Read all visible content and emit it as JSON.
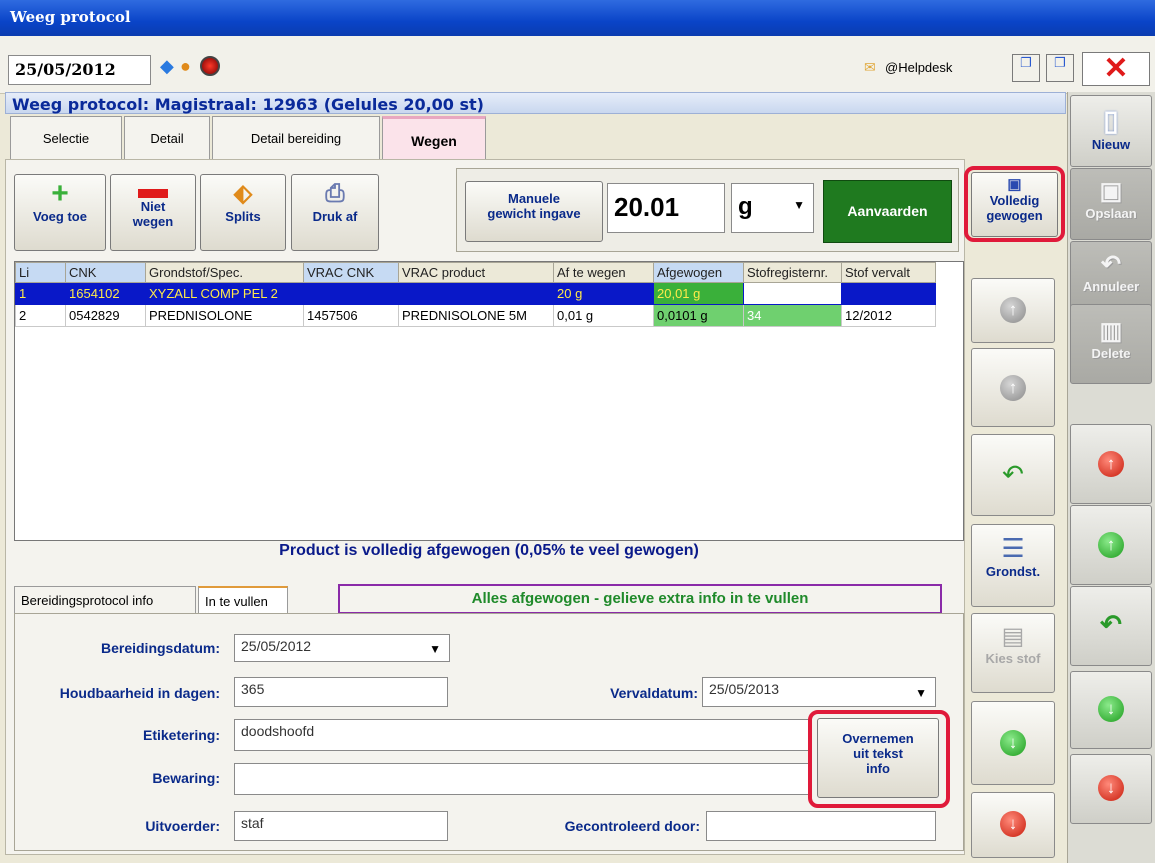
{
  "window": {
    "title": "Weeg protocol"
  },
  "topbar": {
    "date": "25/05/2012",
    "helpdesk": "@Helpdesk"
  },
  "header": {
    "title": "Weeg protocol: Magistraal: 12963 (Gelules 20,00 st)"
  },
  "tabs": [
    "Selectie",
    "Detail",
    "Detail bereiding",
    "Wegen"
  ],
  "toolbar": {
    "add": "Voeg toe",
    "not_weigh_1": "Niet",
    "not_weigh_2": "wegen",
    "split": "Splits",
    "print": "Druk af",
    "manual_1": "Manuele",
    "manual_2": "gewicht ingave",
    "weight_value": "20.01",
    "unit": "g",
    "accept": "Aanvaarden",
    "complete_1": "Volledig",
    "complete_2": "gewogen"
  },
  "grid": {
    "columns": [
      "Li",
      "CNK",
      "Grondstof/Spec.",
      "VRAC CNK",
      "VRAC product",
      "Af te wegen",
      "Afgewogen",
      "Stofregisternr.",
      "Stof vervalt"
    ],
    "rows": [
      [
        "1",
        "1654102",
        "XYZALL COMP PEL 2",
        "",
        "",
        "20 g",
        "20,01 g",
        "",
        ""
      ],
      [
        "2",
        "0542829",
        "PREDNISOLONE",
        "1457506",
        "PREDNISOLONE  5M",
        "0,01 g",
        "0,0101 g",
        "34",
        "12/2012"
      ]
    ]
  },
  "status": "Product is volledig afgewogen (0,05% te veel gewogen)",
  "lower_tabs": [
    "Bereidingsprotocol info",
    "In te vullen"
  ],
  "notice": "Alles afgewogen - gelieve extra info in te vullen",
  "form": {
    "prep_date_label": "Bereidingsdatum:",
    "prep_date": "25/05/2012",
    "shelf_label": "Houdbaarheid in dagen:",
    "shelf": "365",
    "expiry_label": "Vervaldatum:",
    "expiry": "25/05/2013",
    "label_label": "Etiketering:",
    "label_value": "doodshoofd",
    "storage_label": "Bewaring:",
    "storage": "",
    "executor_label": "Uitvoerder:",
    "executor": "staf",
    "checked_label": "Gecontroleerd door:",
    "checked": "",
    "copy_1": "Overnemen",
    "copy_2": "uit tekst",
    "copy_3": "info"
  },
  "side": {
    "raw": "Grondst.",
    "choose": "Kies stof"
  },
  "rightbar": {
    "new": "Nieuw",
    "save": "Opslaan",
    "cancel": "Annuleer",
    "delete": "Delete"
  },
  "colors": {
    "accept_green": "#1f7a1f",
    "highlight_red": "#e01a3a",
    "selected_row": "#0918c8"
  }
}
